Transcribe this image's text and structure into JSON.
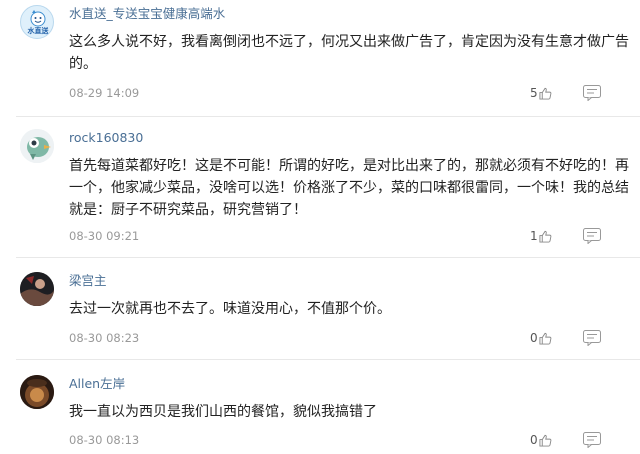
{
  "comments": [
    {
      "username": "水直送_专送宝宝健康高端水",
      "avatar_text": "水直送",
      "content": "这么多人说不好，我看离倒闭也不远了，何况又出来做广告了，肯定因为没有生意才做广告的。",
      "timestamp": "08-29 14:09",
      "likes": "5"
    },
    {
      "username": "rock160830",
      "content": "首先每道菜都好吃！这是不可能！所谓的好吃，是对比出来了的，那就必须有不好吃的！再一个，他家减少菜品，没啥可以选！价格涨了不少，菜的口味都很雷同，一个味！我的总结就是：厨子不研究菜品，研究营销了！",
      "timestamp": "08-30 09:21",
      "likes": "1"
    },
    {
      "username": "梁宫主",
      "content": "去过一次就再也不去了。味道没用心，不值那个价。",
      "timestamp": "08-30 08:23",
      "likes": "0"
    },
    {
      "username": "Allen左岸",
      "content": "我一直以为西贝是我们山西的餐馆，貌似我搞错了",
      "timestamp": "08-30 08:13",
      "likes": "0"
    }
  ],
  "icons": {
    "like": "thumb-up-icon",
    "more": "more-icon"
  },
  "colors": {
    "username": "#4a6f95",
    "text": "#222222",
    "meta": "#999999",
    "divider": "#e8e8e8"
  }
}
